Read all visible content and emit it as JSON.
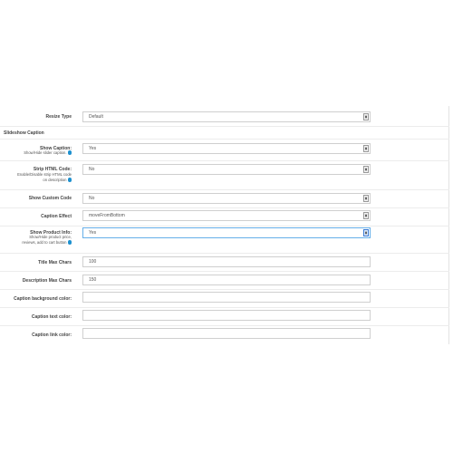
{
  "resize_type": {
    "label": "Resize Type",
    "value": "Default"
  },
  "section_title": "Slideshow Caption",
  "show_caption": {
    "label": "Show Caption:",
    "help": "Show/Hide slider caption.",
    "value": "Yes"
  },
  "strip_html": {
    "label": "Strip HTML Code:",
    "help_lines": [
      "Enable/Disable strip HTML code",
      "on description"
    ],
    "value": "No"
  },
  "show_custom_code": {
    "label": "Show Custom Code",
    "value": "No"
  },
  "caption_effect": {
    "label": "Caption Effect",
    "value": "moveFromBottom"
  },
  "show_product_info": {
    "label": "Show Product Info:",
    "help_lines": [
      "Show/Hide product price,",
      "reviews, add to cart button"
    ],
    "value": "Yes"
  },
  "title_max_chars": {
    "label": "Title Max Chars",
    "value": "100"
  },
  "description_max_chars": {
    "label": "Description Max Chars",
    "value": "150"
  },
  "caption_bg_color": {
    "label": "Caption background color:",
    "value": ""
  },
  "caption_text_color": {
    "label": "Caption text color:",
    "value": ""
  },
  "caption_link_color": {
    "label": "Caption link color:",
    "value": ""
  },
  "icons": {
    "help": "question-circle-icon",
    "select": "select-arrows-icon"
  },
  "colors": {
    "accent": "#1e91cf",
    "required": "#f56b6b",
    "focus_border": "#66afe9"
  }
}
